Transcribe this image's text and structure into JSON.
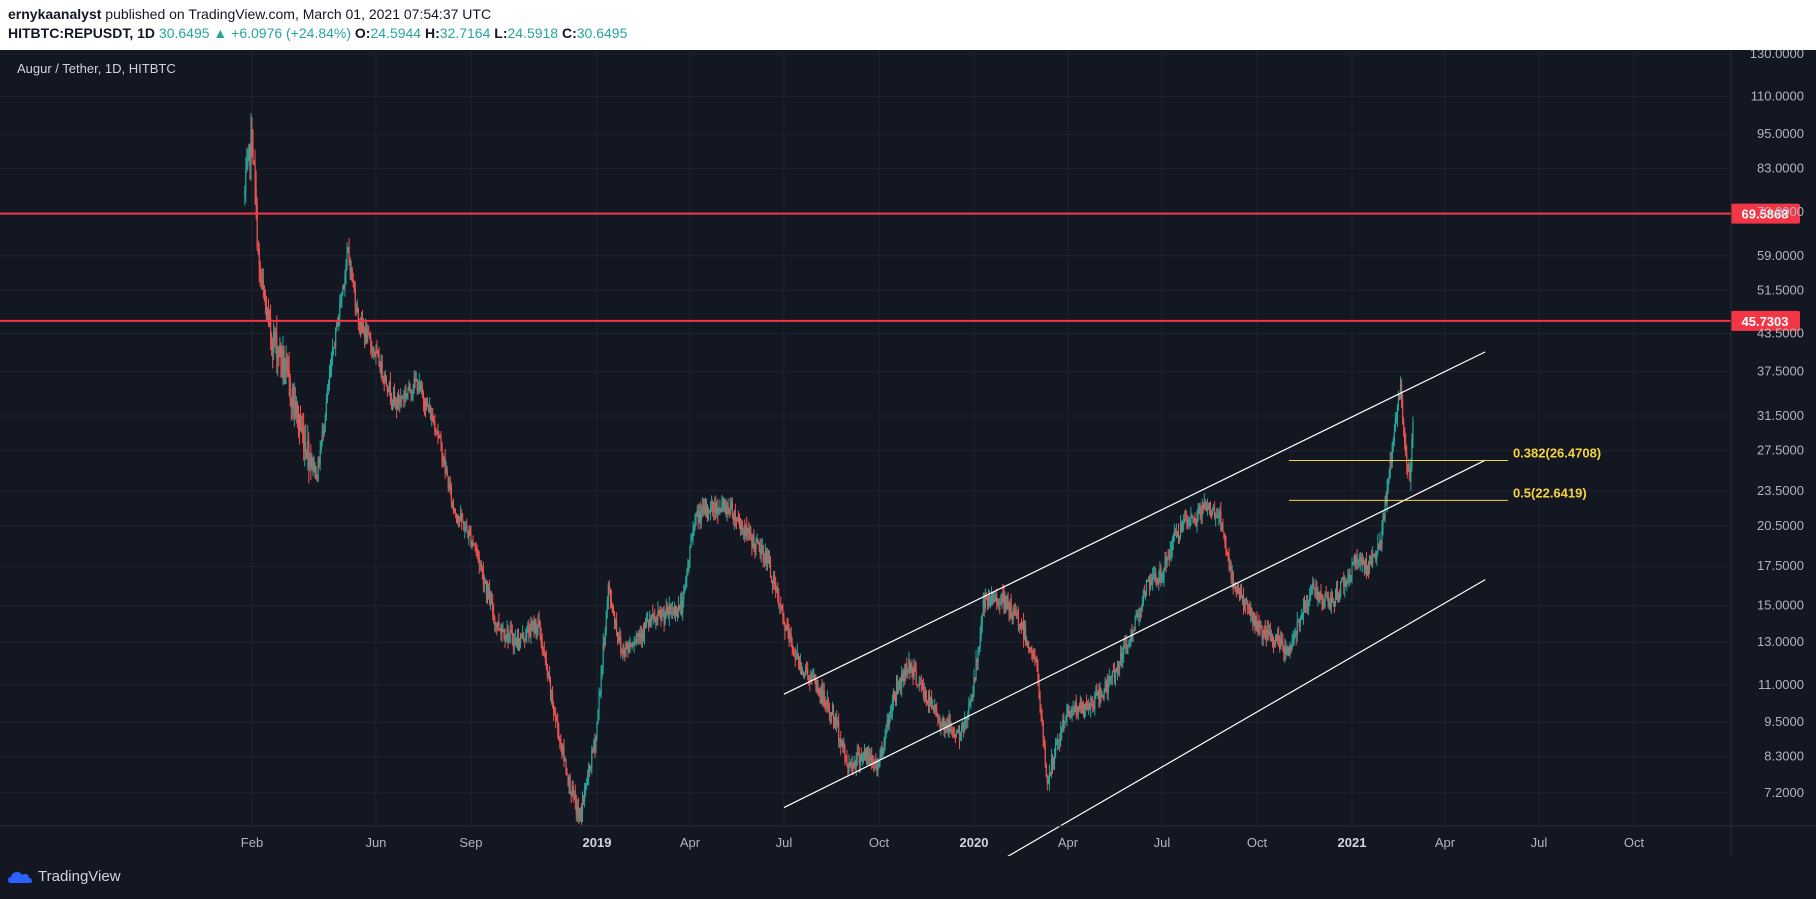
{
  "header": {
    "author": "ernykaanalyst",
    "published_text": " published on TradingView.com, March 01, 2021 07:54:37 UTC",
    "symbol": "HITBTC:REPUSDT, 1D",
    "last": "30.6495",
    "change": "▲ +6.0976 (+24.84%)",
    "o_label": "O:",
    "o_value": "24.5944",
    "h_label": "H:",
    "h_value": "32.7164",
    "l_label": "L:",
    "l_value": "24.5918",
    "c_label": "C:",
    "c_value": "30.6495"
  },
  "chart_legend": "Augur / Tether, 1D, HITBTC",
  "footer": {
    "brand": "TradingView"
  },
  "colors": {
    "bg": "#131722",
    "up": "#26a69a",
    "down": "#ef5350",
    "level": "#f23645",
    "fib": "#f5d33f",
    "channel": "#ffffff"
  },
  "chart_data": {
    "type": "candlestick",
    "scale": "log",
    "y_ticks": [
      "130.0000",
      "110.0000",
      "95.0000",
      "83.0000",
      "70.0000",
      "59.0000",
      "51.5000",
      "43.5000",
      "37.5000",
      "31.5000",
      "27.5000",
      "23.5000",
      "20.5000",
      "17.5000",
      "15.0000",
      "13.0000",
      "11.0000",
      "9.5000",
      "8.3000",
      "7.2000"
    ],
    "x_ticks": [
      {
        "label": "Feb",
        "date": "2018-02-01",
        "bold": false
      },
      {
        "label": "Jun",
        "date": "2018-06-01",
        "bold": false
      },
      {
        "label": "Sep",
        "date": "2018-09-01",
        "bold": false
      },
      {
        "label": "2019",
        "date": "2019-01-01",
        "bold": true
      },
      {
        "label": "Apr",
        "date": "2019-04-01",
        "bold": false
      },
      {
        "label": "Jul",
        "date": "2019-07-01",
        "bold": false
      },
      {
        "label": "Oct",
        "date": "2019-10-01",
        "bold": false
      },
      {
        "label": "2020",
        "date": "2020-01-01",
        "bold": true
      },
      {
        "label": "Apr",
        "date": "2020-04-01",
        "bold": false
      },
      {
        "label": "Jul",
        "date": "2020-07-01",
        "bold": false
      },
      {
        "label": "Oct",
        "date": "2020-10-01",
        "bold": false
      },
      {
        "label": "2021",
        "date": "2021-01-01",
        "bold": true
      },
      {
        "label": "Apr",
        "date": "2021-04-01",
        "bold": false
      },
      {
        "label": "Jul",
        "date": "2021-07-01",
        "bold": false
      },
      {
        "label": "Oct",
        "date": "2021-10-01",
        "bold": false
      }
    ],
    "price_path": [
      [
        "2018-01-25",
        75
      ],
      [
        "2018-02-01",
        95
      ],
      [
        "2018-02-08",
        55
      ],
      [
        "2018-02-18",
        44
      ],
      [
        "2018-03-01",
        40
      ],
      [
        "2018-03-20",
        30
      ],
      [
        "2018-04-05",
        25
      ],
      [
        "2018-04-20",
        40
      ],
      [
        "2018-05-05",
        60
      ],
      [
        "2018-05-15",
        46
      ],
      [
        "2018-06-01",
        40
      ],
      [
        "2018-06-20",
        33
      ],
      [
        "2018-07-10",
        36
      ],
      [
        "2018-07-30",
        30
      ],
      [
        "2018-08-15",
        22
      ],
      [
        "2018-09-05",
        19
      ],
      [
        "2018-09-25",
        14
      ],
      [
        "2018-10-15",
        13
      ],
      [
        "2018-11-05",
        14
      ],
      [
        "2018-11-20",
        10
      ],
      [
        "2018-12-05",
        7.5
      ],
      [
        "2018-12-15",
        6.5
      ],
      [
        "2018-12-31",
        9
      ],
      [
        "2019-01-12",
        16
      ],
      [
        "2019-01-25",
        12.5
      ],
      [
        "2019-02-20",
        14
      ],
      [
        "2019-03-10",
        14.5
      ],
      [
        "2019-03-25",
        15
      ],
      [
        "2019-04-05",
        21
      ],
      [
        "2019-04-20",
        22
      ],
      [
        "2019-05-10",
        22
      ],
      [
        "2019-05-25",
        20
      ],
      [
        "2019-06-15",
        18
      ],
      [
        "2019-07-01",
        14
      ],
      [
        "2019-07-15",
        12
      ],
      [
        "2019-08-01",
        11
      ],
      [
        "2019-08-20",
        9.5
      ],
      [
        "2019-09-01",
        8
      ],
      [
        "2019-09-15",
        8.4
      ],
      [
        "2019-09-30",
        8
      ],
      [
        "2019-10-15",
        10.5
      ],
      [
        "2019-10-30",
        12
      ],
      [
        "2019-11-15",
        10.5
      ],
      [
        "2019-12-01",
        9.5
      ],
      [
        "2019-12-20",
        9
      ],
      [
        "2020-01-01",
        11
      ],
      [
        "2020-01-10",
        15
      ],
      [
        "2020-01-25",
        15.5
      ],
      [
        "2020-02-15",
        14
      ],
      [
        "2020-03-01",
        12
      ],
      [
        "2020-03-12",
        7.5
      ],
      [
        "2020-03-20",
        8.5
      ],
      [
        "2020-04-01",
        10
      ],
      [
        "2020-04-20",
        10
      ],
      [
        "2020-05-10",
        11
      ],
      [
        "2020-05-30",
        13
      ],
      [
        "2020-06-15",
        16
      ],
      [
        "2020-07-01",
        17
      ],
      [
        "2020-07-15",
        20
      ],
      [
        "2020-08-01",
        21
      ],
      [
        "2020-08-10",
        22
      ],
      [
        "2020-08-25",
        21.5
      ],
      [
        "2020-09-05",
        17
      ],
      [
        "2020-09-20",
        15
      ],
      [
        "2020-10-05",
        13.5
      ],
      [
        "2020-10-20",
        13
      ],
      [
        "2020-11-01",
        12.5
      ],
      [
        "2020-11-15",
        15
      ],
      [
        "2020-11-25",
        16
      ],
      [
        "2020-12-10",
        15
      ],
      [
        "2020-12-25",
        16.5
      ],
      [
        "2021-01-05",
        18
      ],
      [
        "2021-01-15",
        17.5
      ],
      [
        "2021-01-28",
        19
      ],
      [
        "2021-02-05",
        24
      ],
      [
        "2021-02-12",
        31
      ],
      [
        "2021-02-17",
        35
      ],
      [
        "2021-02-22",
        27
      ],
      [
        "2021-02-26",
        24.6
      ],
      [
        "2021-03-01",
        30.65
      ]
    ],
    "horizontal_levels": [
      {
        "value": 69.5868,
        "label": "69.5868"
      },
      {
        "value": 45.7303,
        "label": "45.7303"
      }
    ],
    "fib_levels": [
      {
        "label": "0.382(26.4708)",
        "value": 26.4708,
        "from": "2020-11-01",
        "to": "2021-06-01"
      },
      {
        "label": "0.5(22.6419)",
        "value": 22.6419,
        "from": "2020-11-01",
        "to": "2021-06-01"
      }
    ],
    "channel_lines": [
      {
        "from": [
          "2019-07-01",
          10.6
        ],
        "to": [
          "2021-05-10",
          40.5
        ]
      },
      {
        "from": [
          "2019-07-01",
          6.8
        ],
        "to": [
          "2021-05-10",
          26.5
        ]
      },
      {
        "from": [
          "2019-12-15",
          5.0
        ],
        "to": [
          "2021-05-10",
          16.6
        ]
      }
    ]
  }
}
